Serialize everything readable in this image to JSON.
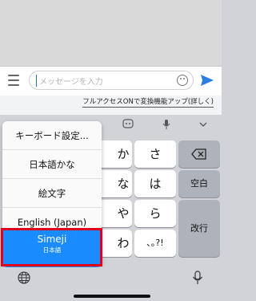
{
  "message_bar": {
    "placeholder": "メッセージを入力"
  },
  "keyboard_header": {
    "full_access_link": "フルアクセスONで変換機能アップ(詳しく)"
  },
  "input_menu": {
    "items": [
      {
        "label": "キーボード設定..."
      },
      {
        "label": "日本語かな"
      },
      {
        "label": "絵文字"
      },
      {
        "label": "English (Japan)"
      },
      {
        "label": "Simeji",
        "sublabel": "日本語",
        "selected": true
      }
    ]
  },
  "keys": {
    "ka": "か",
    "sa": "さ",
    "na": "な",
    "ha": "は",
    "ya": "や",
    "ra": "ら",
    "wa": "わ",
    "punct": "､｡?!",
    "space": "空白",
    "enter": "改行"
  },
  "colors": {
    "selected_bg": "#1a8cff",
    "highlight_border": "#e0001b",
    "send_icon": "#2a7de1"
  }
}
